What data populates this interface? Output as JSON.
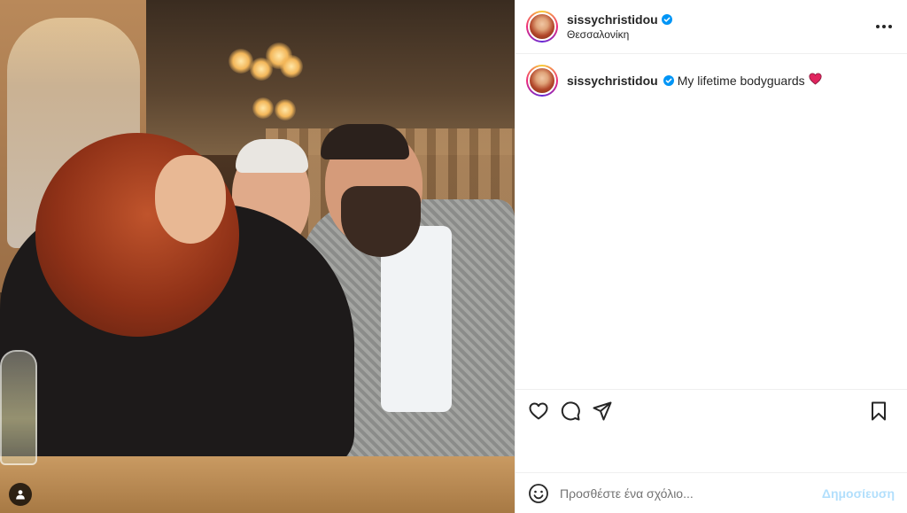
{
  "post": {
    "username": "sissychristidou",
    "location": "Θεσσαλονίκη",
    "verified": true,
    "caption": {
      "username": "sissychristidou",
      "text": "My lifetime bodyguards",
      "emoji": "❤️"
    }
  },
  "icons": {
    "more": "more-options-icon",
    "like": "heart-icon",
    "comment": "comment-icon",
    "share": "share-icon",
    "save": "bookmark-icon",
    "emoji": "emoji-icon",
    "tagged_user": "user-tag-icon",
    "verified": "verified-badge-icon"
  },
  "comment_box": {
    "placeholder": "Προσθέστε ένα σχόλιο...",
    "post_label": "Δημοσίευση"
  },
  "colors": {
    "verified_blue": "#0095f6",
    "heart_red": "#e0245e",
    "post_button_disabled": "#b2dffc",
    "divider": "#efefef"
  }
}
